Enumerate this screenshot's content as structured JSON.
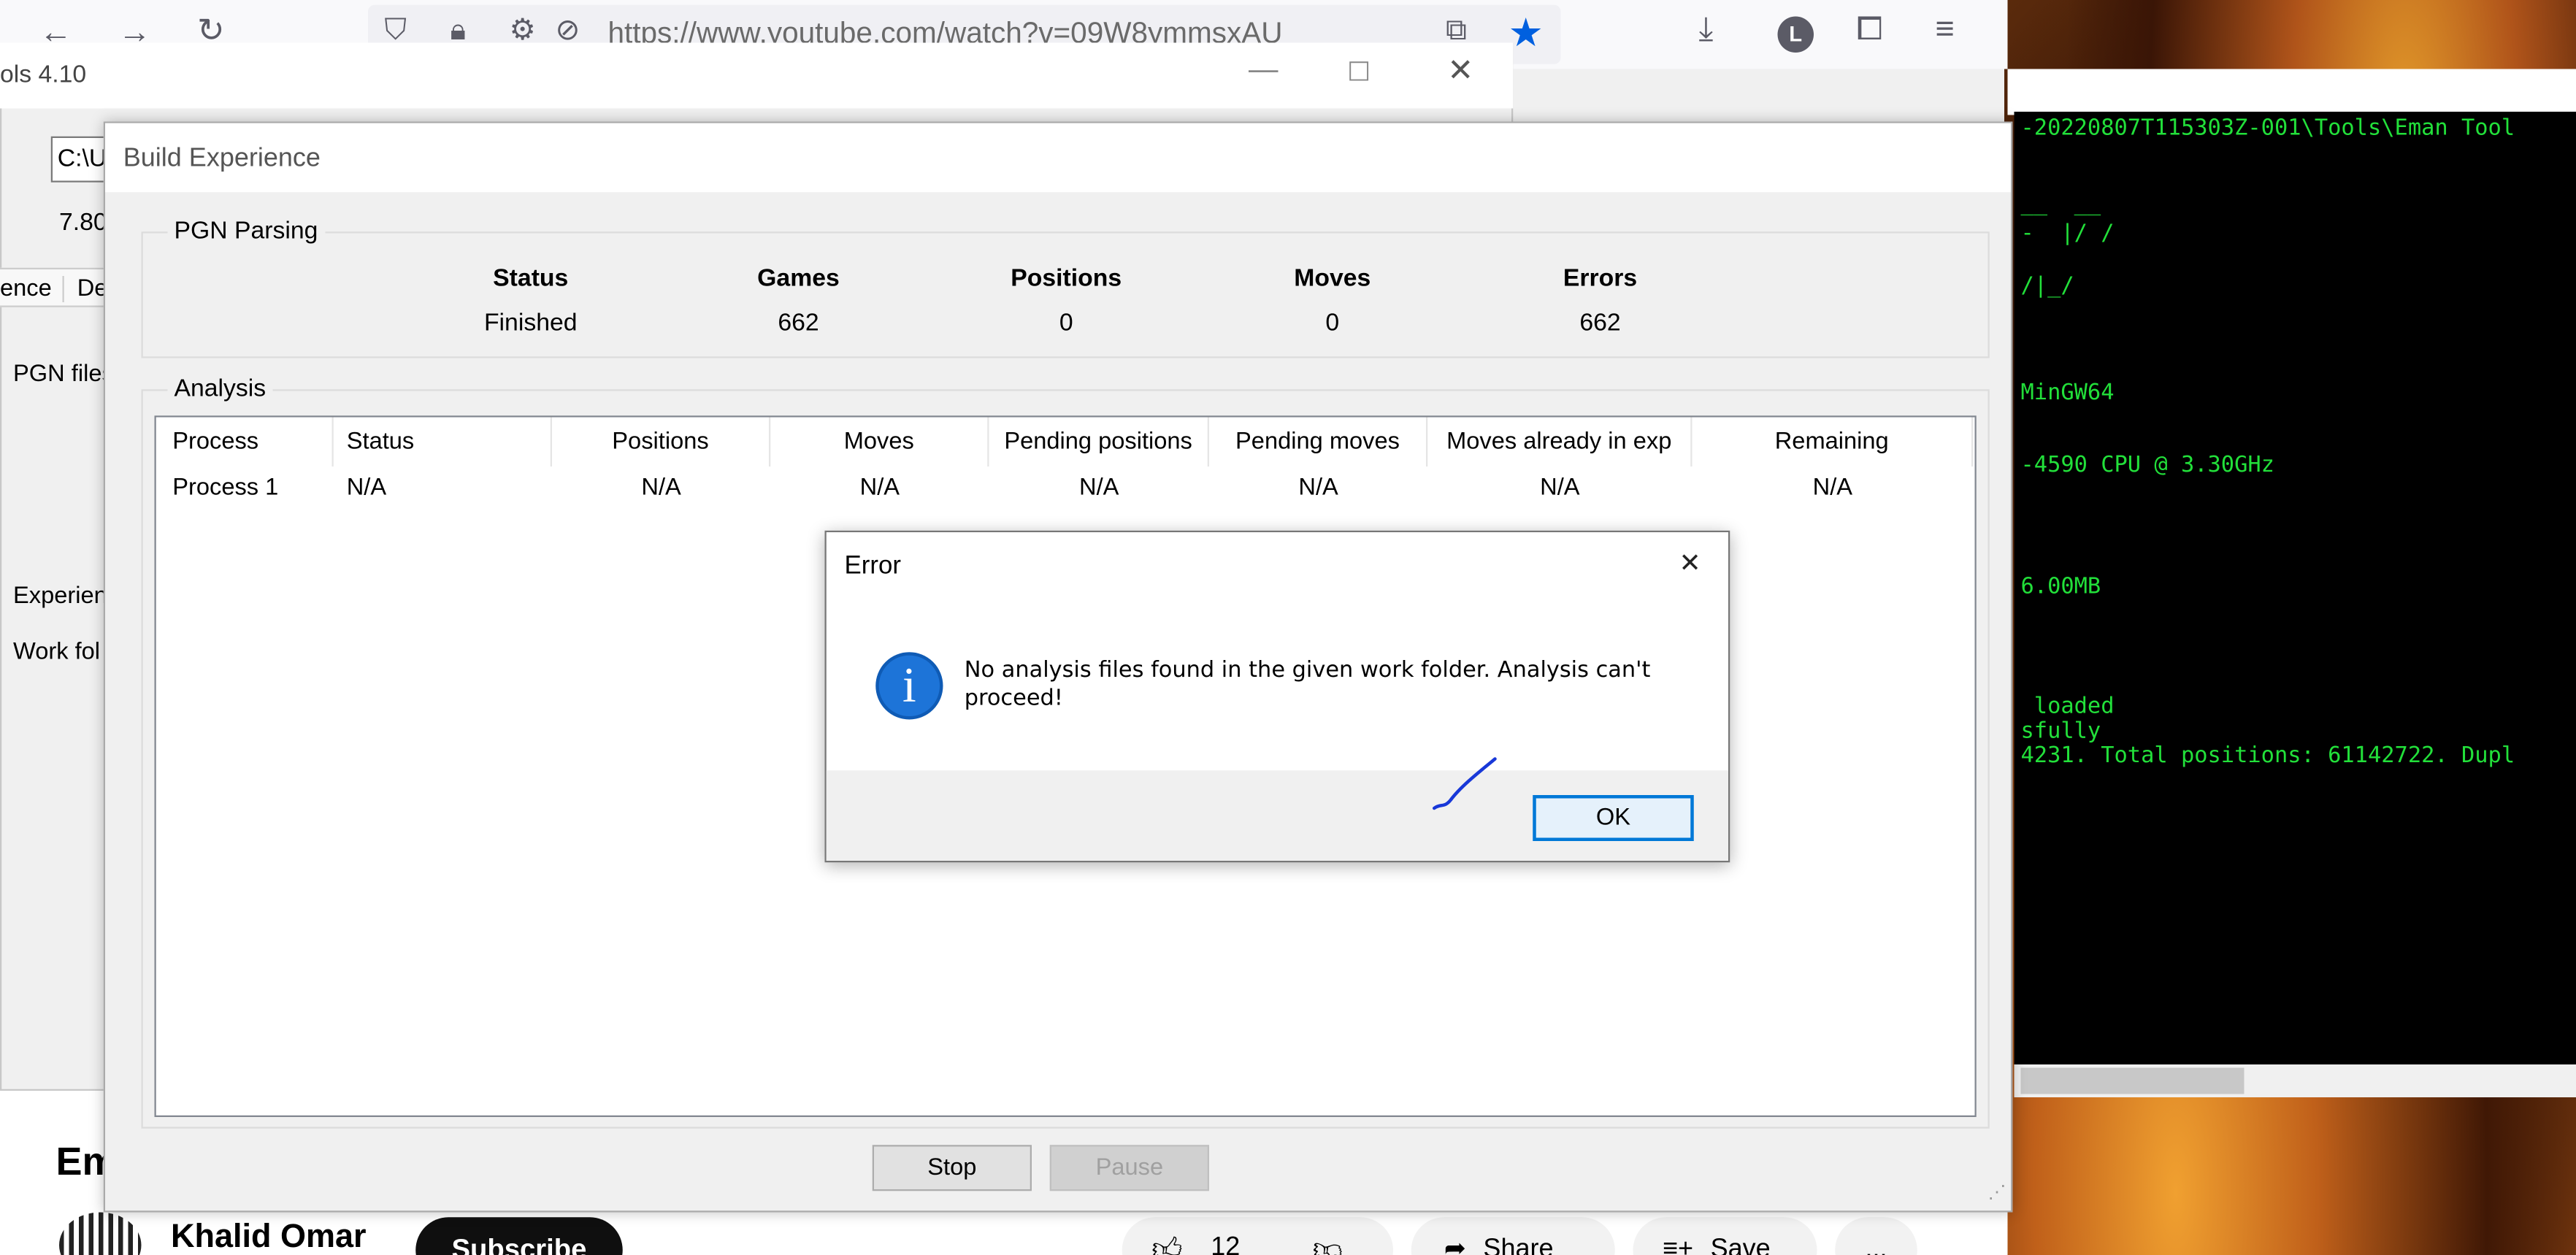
{
  "browser": {
    "url": "https://www.youtube.com/watch?v=09W8ymmsxAU",
    "avatar_letter": "L",
    "star_color": "#0060df"
  },
  "tool_window": {
    "title": "ols 4.10",
    "path_field": "C:\\U",
    "version": "7.80",
    "tab_partial_1": "ence",
    "tab_partial_2": "De",
    "label_pgn": "PGN files",
    "label_experience": "Experien",
    "label_work": "Work fol"
  },
  "terminal": {
    "lines": [
      "-20220807T115303Z-001\\Tools\\Eman Tool",
      "__  __",
      "-  |/ /",
      "/|_/",
      "MinGW64",
      "-4590 CPU @ 3.30GHz",
      "6.00MB",
      " loaded",
      "sfully",
      "4231. Total positions: 61142722. Dupl"
    ],
    "text_color": "#22e03a"
  },
  "youtube": {
    "title_partial": "Em",
    "channel": "Khalid Omar",
    "subscribe": "Subscribe",
    "like_count": "12",
    "share": "Share",
    "save": "Save",
    "more": "..."
  },
  "build_experience": {
    "title": "Build Experience",
    "pgn_group": "PGN Parsing",
    "pgn_headers": [
      "Status",
      "Games",
      "Positions",
      "Moves",
      "Errors"
    ],
    "pgn_values": [
      "Finished",
      "662",
      "0",
      "0",
      "662"
    ],
    "analysis_group": "Analysis",
    "analysis_headers": [
      "Process",
      "Status",
      "Positions",
      "Moves",
      "Pending positions",
      "Pending moves",
      "Moves already in exp",
      "Remaining"
    ],
    "analysis_rows": [
      [
        "Process 1",
        "N/A",
        "N/A",
        "N/A",
        "N/A",
        "N/A",
        "N/A",
        "N/A"
      ]
    ],
    "stop": "Stop",
    "pause": "Pause"
  },
  "error_dialog": {
    "title": "Error",
    "icon": "info-icon",
    "icon_glyph": "i",
    "message": "No analysis files found in the given work folder. Analysis can't proceed!",
    "ok": "OK",
    "accent_color": "#0078d7"
  }
}
